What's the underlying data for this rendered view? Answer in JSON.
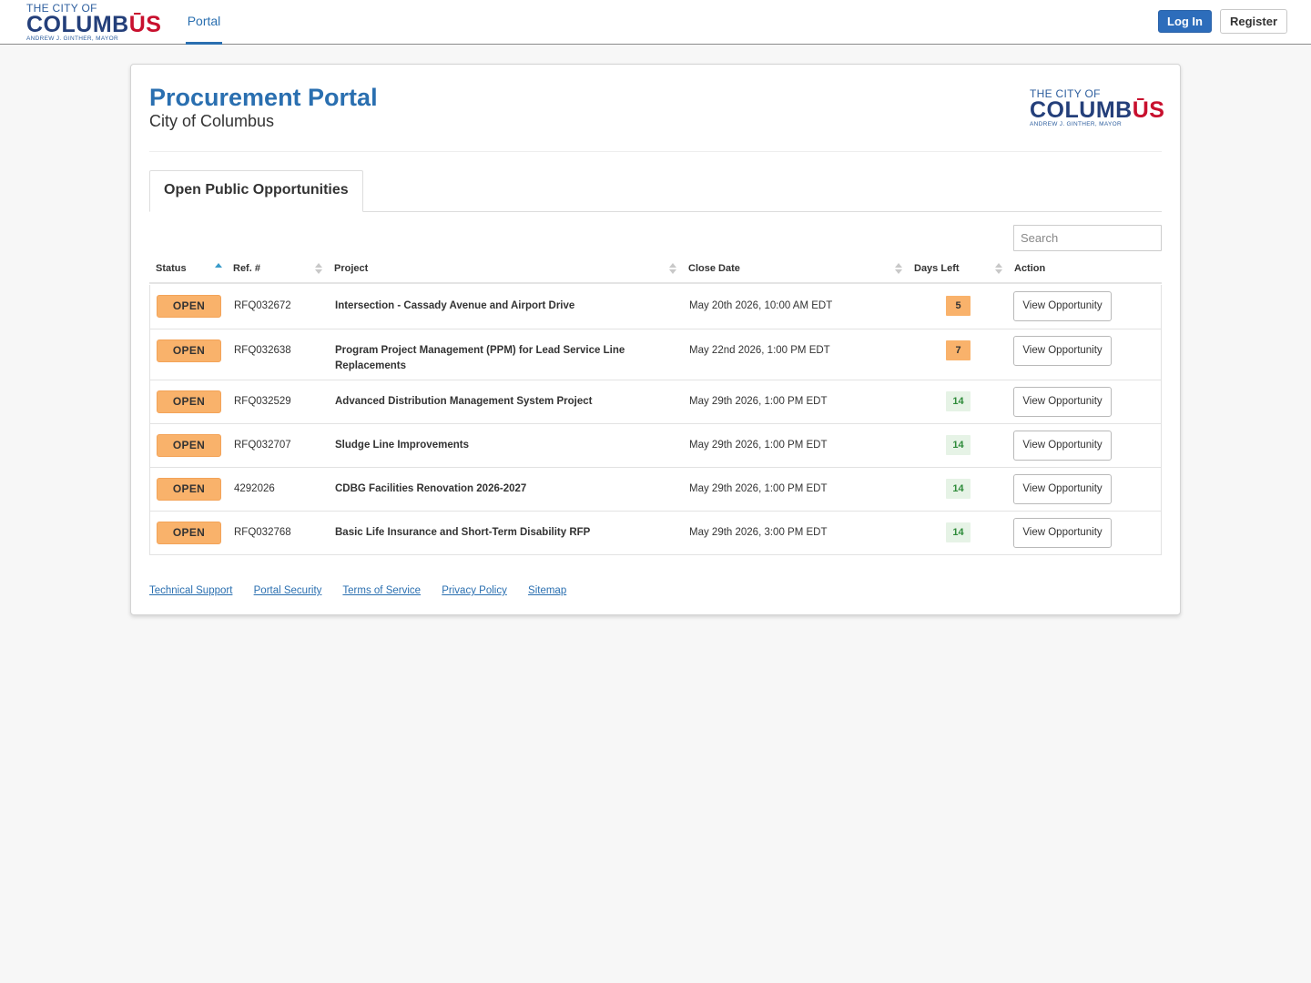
{
  "navbar": {
    "logo": {
      "line1": "THE CITY OF",
      "line2_main": "COLUMB",
      "line2_red": "ŪS",
      "line3": "ANDREW J. GINTHER, MAYOR"
    },
    "tab": "Portal",
    "login_label": "Log In",
    "register_label": "Register"
  },
  "header": {
    "title": "Procurement Portal",
    "subtitle": "City of Columbus",
    "logo": {
      "line1": "THE CITY OF",
      "line2_main": "COLUMB",
      "line2_red": "ŪS",
      "line3": "ANDREW J. GINTHER, MAYOR"
    }
  },
  "tabs": {
    "active": "Open Public Opportunities"
  },
  "search": {
    "placeholder": "Search",
    "value": ""
  },
  "table": {
    "columns": [
      "Status",
      "Ref. #",
      "Project",
      "Close Date",
      "Days Left",
      "Action"
    ],
    "sorted_column": "Status",
    "rows": [
      {
        "status": "OPEN",
        "ref": "RFQ032672",
        "project": "Intersection - Cassady Avenue and Airport Drive",
        "close_date": "May 20th 2026, 10:00 AM EDT",
        "days_left": "5",
        "action": "View Opportunity"
      },
      {
        "status": "OPEN",
        "ref": "RFQ032638",
        "project": "Program Project Management (PPM) for Lead Service Line Replacements",
        "close_date": "May 22nd 2026, 1:00 PM EDT",
        "days_left": "7",
        "action": "View Opportunity"
      },
      {
        "status": "OPEN",
        "ref": "RFQ032529",
        "project": "Advanced Distribution Management System Project",
        "close_date": "May 29th 2026, 1:00 PM EDT",
        "days_left": "14",
        "action": "View Opportunity"
      },
      {
        "status": "OPEN",
        "ref": "RFQ032707",
        "project": "Sludge Line Improvements",
        "close_date": "May 29th 2026, 1:00 PM EDT",
        "days_left": "14",
        "action": "View Opportunity"
      },
      {
        "status": "OPEN",
        "ref": "4292026",
        "project": "CDBG Facilities Renovation 2026-2027",
        "close_date": "May 29th 2026, 1:00 PM EDT",
        "days_left": "14",
        "action": "View Opportunity"
      },
      {
        "status": "OPEN",
        "ref": "RFQ032768",
        "project": "Basic Life Insurance and Short-Term Disability RFP",
        "close_date": "May 29th 2026, 3:00 PM EDT",
        "days_left": "14",
        "action": "View Opportunity"
      }
    ]
  },
  "footer": {
    "links": [
      "Technical Support",
      "Portal Security",
      "Terms of Service",
      "Privacy Policy",
      "Sitemap"
    ]
  },
  "colors": {
    "brand_blue": "#2a6fb0",
    "logo_navy": "#243f7a",
    "logo_red": "#c8102e",
    "open_badge": "#f9b26b",
    "days_ok_bg": "#e6f3e6",
    "days_ok_text": "#2e8b3a",
    "login_button": "#2d6dbb"
  }
}
